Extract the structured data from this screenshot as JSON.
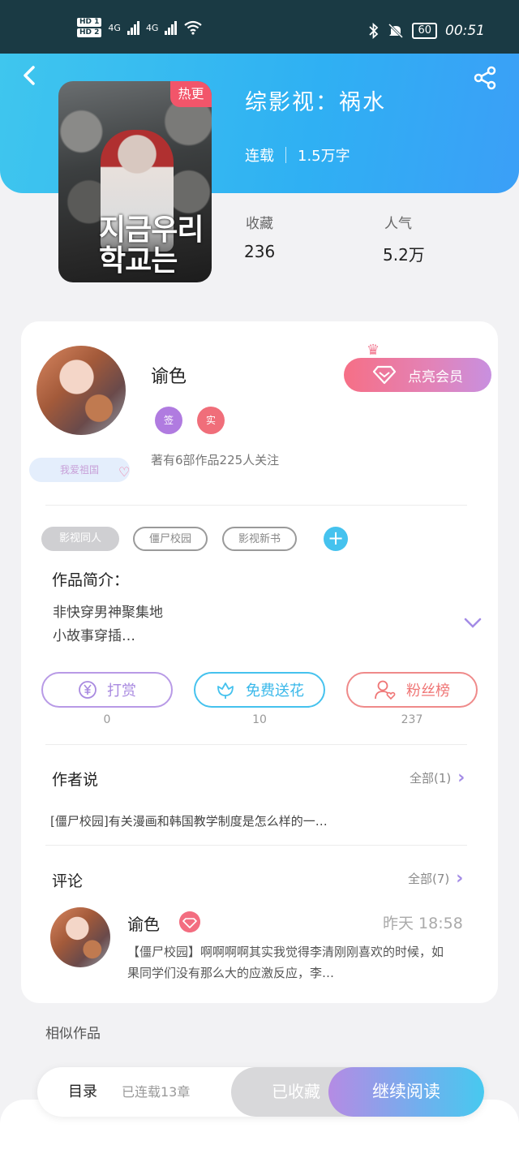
{
  "status_bar": {
    "hd1": "HD 1",
    "hd2": "HD 2",
    "net1": "4G",
    "net2": "4G",
    "battery": "60",
    "time": "00:51"
  },
  "book": {
    "hot_badge": "热更",
    "title": "综影视：祸水",
    "status": "连载",
    "word_count": "1.5万字",
    "collect_label": "收藏",
    "collect_value": "236",
    "popularity_label": "人气",
    "popularity_value": "5.2万",
    "cover_title_line1": "지금우리",
    "cover_title_line2": "학교는"
  },
  "author": {
    "name": "谕色",
    "badge_sign": "签",
    "badge_real": "实",
    "stats": "著有6部作品225人关注",
    "tag": "我爱祖国",
    "vip_button": "点亮会员"
  },
  "tags": [
    "影视同人",
    "僵尸校园",
    "影视新书"
  ],
  "intro": {
    "label": "作品简介：",
    "line1": "非快穿男神聚集地",
    "line2": "小故事穿插…"
  },
  "actions": {
    "reward_label": "打赏",
    "reward_count": "0",
    "flower_label": "免费送花",
    "flower_count": "10",
    "fans_label": "粉丝榜",
    "fans_count": "237"
  },
  "author_says": {
    "title": "作者说",
    "all": "全部(1)",
    "content": "[僵尸校园]有关漫画和韩国教学制度是怎么样的一…"
  },
  "comments": {
    "title": "评论",
    "all": "全部(7)",
    "item": {
      "name": "谕色",
      "time": "昨天 18:58",
      "text": "【僵尸校园】啊啊啊啊其实我觉得李清刚刚喜欢的时候，如果同学们没有那么大的应激反应，李…"
    }
  },
  "similar": "相似作品",
  "bottom_bar": {
    "toc": "目录",
    "toc_status": "已连载13章",
    "collected": "已收藏",
    "continue": "继续阅读"
  },
  "colors": {
    "header_gradient_start": "#3fc6ee",
    "header_gradient_end": "#3b9ff7",
    "hot_badge": "#f2556a",
    "reward": "#a98ae0",
    "flower": "#45c2ee",
    "fans": "#ef7676"
  }
}
